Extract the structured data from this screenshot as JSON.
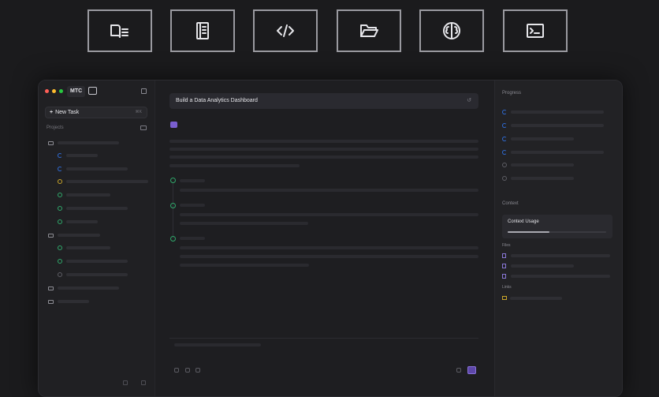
{
  "feature_icons": [
    "book-icon",
    "notebook-icon",
    "code-icon",
    "folder-open-icon",
    "brain-icon",
    "terminal-icon"
  ],
  "window": {
    "traffic_lights": [
      "#ff5f57",
      "#febc2e",
      "#28c840"
    ],
    "org_label": "MTC",
    "new_task_label": "New Task",
    "new_task_shortcut": "⌘K",
    "projects_label": "Projects",
    "task_title": "Build a Data Analytics Dashboard",
    "progress_label": "Progress",
    "context_label": "Context",
    "context_usage_label": "Context Usage",
    "context_usage_fraction": 0.42,
    "files_label": "Files",
    "links_label": "Links",
    "progress_states": [
      "in-progress",
      "in-progress",
      "in-progress",
      "in-progress",
      "pending",
      "pending"
    ]
  },
  "colors": {
    "accent": "#7a5fd0",
    "in_progress": "#2f6bd6",
    "done": "#2fa86b",
    "warning": "#c9a52a"
  }
}
